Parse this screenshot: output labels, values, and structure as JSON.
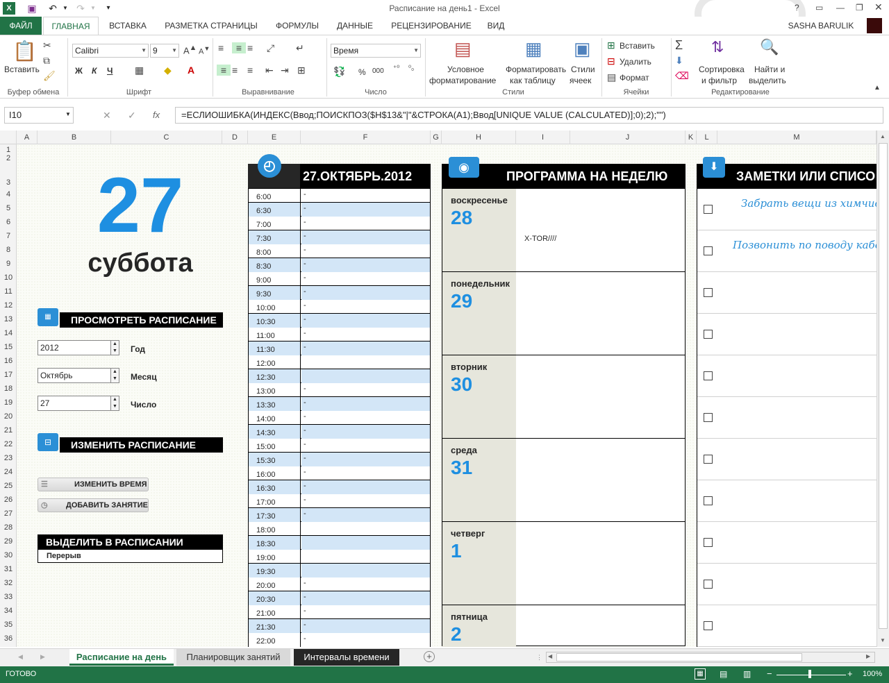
{
  "window": {
    "title": "Расписание на день1 - Excel",
    "user": "SASHA BARULIK"
  },
  "tabs": [
    "ФАЙЛ",
    "ГЛАВНАЯ",
    "ВСТАВКА",
    "РАЗМЕТКА СТРАНИЦЫ",
    "ФОРМУЛЫ",
    "ДАННЫЕ",
    "РЕЦЕНЗИРОВАНИЕ",
    "ВИД"
  ],
  "ribbon": {
    "paste": "Вставить",
    "clipboard": "Буфер обмена",
    "font": {
      "name": "Calibri",
      "size": "9",
      "group": "Шрифт",
      "bold": "Ж",
      "italic": "К",
      "underline": "Ч"
    },
    "align_group": "Выравнивание",
    "number": {
      "format": "Время",
      "group": "Число",
      "percent": "%",
      "thousands": "000"
    },
    "styles": {
      "cond1": "Условное",
      "cond2": "форматирование",
      "table1": "Форматировать",
      "table2": "как таблицу",
      "cell1": "Стили",
      "cell2": "ячеек",
      "group": "Стили"
    },
    "cells": {
      "insert": "Вставить",
      "delete": "Удалить",
      "format": "Формат",
      "group": "Ячейки"
    },
    "editing": {
      "sort1": "Сортировка",
      "sort2": "и фильтр",
      "find1": "Найти и",
      "find2": "выделить",
      "group": "Редактирование"
    }
  },
  "formula": {
    "cell": "I10",
    "text": "=ЕСЛИОШИБКА(ИНДЕКС(Ввод;ПОИСКПОЗ($H$13&\"|\"&СТРОКА(A1);Ввод[UNIQUE VALUE (CALCULATED)];0);2);\"\")"
  },
  "columns": [
    "A",
    "B",
    "C",
    "D",
    "E",
    "F",
    "G",
    "H",
    "I",
    "J",
    "K",
    "L",
    "M"
  ],
  "rows": [
    "1",
    "2",
    "3",
    "4",
    "5",
    "6",
    "7",
    "8",
    "9",
    "10",
    "11",
    "12",
    "13",
    "14",
    "15",
    "16",
    "17",
    "18",
    "19",
    "20",
    "21",
    "22",
    "23",
    "24",
    "25",
    "26",
    "27",
    "28",
    "29",
    "30",
    "31",
    "32",
    "33",
    "34",
    "35",
    "36"
  ],
  "sheet": {
    "day_number": "27",
    "weekday": "суббота",
    "view_header": "ПРОСМОТРЕТЬ РАСПИСАНИЕ",
    "year_value": "2012",
    "year_label": "Год",
    "month_value": "Октябрь",
    "month_label": "Месяц",
    "day_value": "27",
    "day_label": "Число",
    "change_header": "ИЗМЕНИТЬ РАСПИСАНИЕ",
    "change_time_btn": "ИЗМЕНИТЬ ВРЕМЯ",
    "add_class_btn": "ДОБАВИТЬ ЗАНЯТИЕ",
    "highlight_header": "ВЫДЕЛИТЬ В РАСПИСАНИИ",
    "highlight_value": "Перерыв"
  },
  "schedule": {
    "date": "27.ОКТЯБРЬ.2012",
    "times": [
      "6:00",
      "6:30",
      "7:00",
      "7:30",
      "8:00",
      "8:30",
      "9:00",
      "9:30",
      "10:00",
      "10:30",
      "11:00",
      "11:30",
      "12:00",
      "12:30",
      "13:00",
      "13:30",
      "14:00",
      "14:30",
      "15:00",
      "15:30",
      "16:00",
      "16:30",
      "17:00",
      "17:30",
      "18:00",
      "18:30",
      "19:00",
      "19:30",
      "20:00",
      "20:30",
      "21:00",
      "21:30",
      "22:00"
    ],
    "values": [
      "-",
      "-",
      "-",
      "-",
      "-",
      "-",
      "-",
      "-",
      "-",
      "-",
      "-",
      "-",
      "",
      "",
      "-",
      "-",
      "-",
      "-",
      "-",
      "-",
      "-",
      "-",
      "-",
      "-",
      "",
      "",
      "",
      "",
      "-",
      "-",
      "-",
      "-",
      "-"
    ]
  },
  "week": {
    "header": "ПРОГРАММА НА НЕДЕЛЮ",
    "days": [
      {
        "name": "воскресенье",
        "num": "28",
        "note": "X-TOR////"
      },
      {
        "name": "понедельник",
        "num": "29",
        "note": ""
      },
      {
        "name": "вторник",
        "num": "30",
        "note": ""
      },
      {
        "name": "среда",
        "num": "31",
        "note": ""
      },
      {
        "name": "четверг",
        "num": "1",
        "note": ""
      },
      {
        "name": "пятница",
        "num": "2",
        "note": ""
      }
    ]
  },
  "notes": {
    "header": "ЗАМЕТКИ ИЛИ СПИСО",
    "items": [
      "Забрать вещи из химчис",
      "Позвонить по поводу кабе",
      "",
      "",
      "",
      "",
      "",
      "",
      "",
      "",
      ""
    ]
  },
  "sheet_tabs": [
    "Расписание на день",
    "Планировщик занятий",
    "Интервалы времени"
  ],
  "status": {
    "ready": "ГОТОВО",
    "zoom": "100%"
  },
  "colors": {
    "excel_green": "#217346",
    "accent_blue": "#1e8fe1",
    "alt_row": "#d3e6f7"
  }
}
